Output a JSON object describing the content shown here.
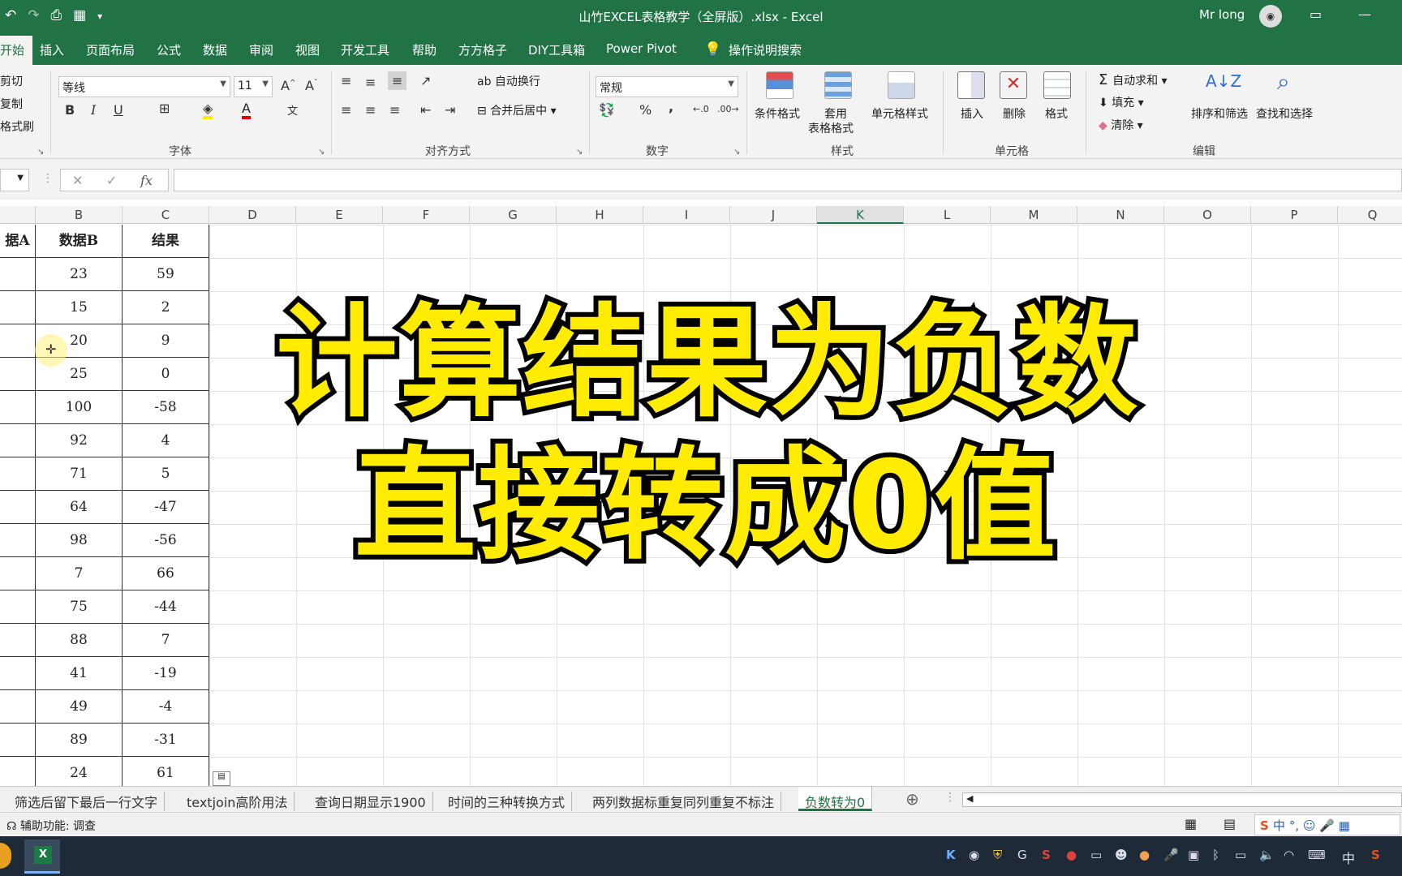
{
  "titlebar": {
    "title": "山竹EXCEL表格教学（全屏版）.xlsx  -  Excel",
    "user": "Mr long",
    "undo": "↶",
    "redo": "↷"
  },
  "tabs": [
    "开始",
    "插入",
    "页面布局",
    "公式",
    "数据",
    "审阅",
    "视图",
    "开发工具",
    "帮助",
    "方方格子",
    "DIY工具箱",
    "Power Pivot",
    "操作说明搜索"
  ],
  "ribbon": {
    "clipboard": [
      "剪切",
      "复制",
      "格式刷"
    ],
    "font": {
      "name": "等线",
      "size": "11",
      "bold": "B",
      "italic": "I",
      "underline": "U",
      "label": "字体"
    },
    "align": {
      "wrap": "自动换行",
      "merge": "合并后居中",
      "label": "对齐方式"
    },
    "number": {
      "format": "常规",
      "percent": "%",
      "comma": ",",
      "label": "数字"
    },
    "styles": {
      "cond": "条件格式",
      "table1": "套用",
      "table2": "表格格式",
      "cell": "单元格样式",
      "label": "样式"
    },
    "cells": {
      "insert": "插入",
      "delete": "删除",
      "format": "格式",
      "label": "单元格"
    },
    "edit": {
      "autosum": "自动求和",
      "fill": "填充",
      "clear": "清除",
      "sort": "排序和筛选",
      "find": "查找和选择",
      "label": "编辑"
    }
  },
  "formula": {
    "fx": "fx",
    "cancel": "✕",
    "enter": "✓"
  },
  "columns": [
    "B",
    "C",
    "D",
    "E",
    "F",
    "G",
    "H",
    "I",
    "J",
    "K",
    "L",
    "M",
    "N",
    "O",
    "P",
    "Q"
  ],
  "table": {
    "col_a_header": "据A",
    "header_b": "数据B",
    "header_c": "结果",
    "b": [
      "23",
      "15",
      "20",
      "25",
      "100",
      "92",
      "71",
      "64",
      "98",
      "7",
      "75",
      "88",
      "41",
      "49",
      "89",
      "24"
    ],
    "c": [
      "59",
      "2",
      "9",
      "0",
      "-58",
      "4",
      "5",
      "-47",
      "-56",
      "66",
      "-44",
      "7",
      "-19",
      "-4",
      "-31",
      "61"
    ]
  },
  "overlay": [
    "计算结果为负数",
    "直接转成0值"
  ],
  "sheets": [
    "筛选后留下最后一行文字",
    "textjoin高阶用法",
    "查询日期显示1900",
    "时间的三种转换方式",
    "两列数据标重复同列重复不标注",
    "负数转为0"
  ],
  "status": {
    "accessibility": "辅助功能: 调查"
  },
  "taskbar": {
    "ime": "中"
  }
}
